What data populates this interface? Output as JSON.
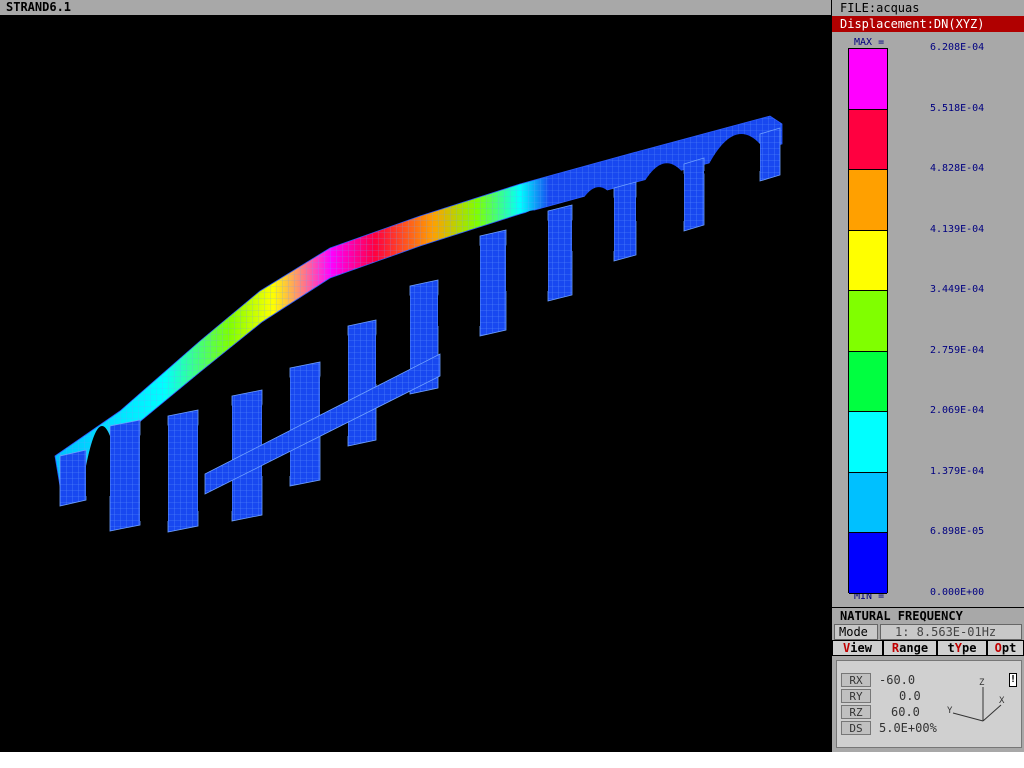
{
  "window": {
    "title": "STRAND6.1"
  },
  "file": {
    "label": "FILE:acquas"
  },
  "result": {
    "label": "Displacement:DN(XYZ)"
  },
  "legend": {
    "max_tag": "MAX =",
    "min_tag": "MIN =",
    "values": [
      "6.208E-04",
      "5.518E-04",
      "4.828E-04",
      "4.139E-04",
      "3.449E-04",
      "2.759E-04",
      "2.069E-04",
      "1.379E-04",
      "6.898E-05",
      "0.000E+00"
    ],
    "colors": [
      "#ff00ff",
      "#ff0040",
      "#ffa000",
      "#ffff00",
      "#80ff00",
      "#00ff40",
      "#00ffff",
      "#00c0ff",
      "#0000ff"
    ]
  },
  "natural_frequency": {
    "header": "NATURAL FREQUENCY",
    "mode_label": "Mode",
    "mode_value": "1: 8.563E-01Hz"
  },
  "menu": [
    {
      "hot": "V",
      "rest": "iew"
    },
    {
      "hot": "R",
      "rest": "ange"
    },
    {
      "pre": "t",
      "hot": "Y",
      "rest": "pe"
    },
    {
      "hot": "O",
      "rest": "pt"
    }
  ],
  "view": {
    "rx_label": "RX",
    "rx": "-60.0",
    "ry_label": "RY",
    "ry": "0.0",
    "rz_label": "RZ",
    "rz": "60.0",
    "ds_label": "DS",
    "ds": "5.0E+00%",
    "axis_x": "X",
    "axis_y": "Y",
    "axis_z": "Z"
  },
  "model_colors": {
    "base": "#1848f0",
    "mesh": "#6ea0ff"
  }
}
